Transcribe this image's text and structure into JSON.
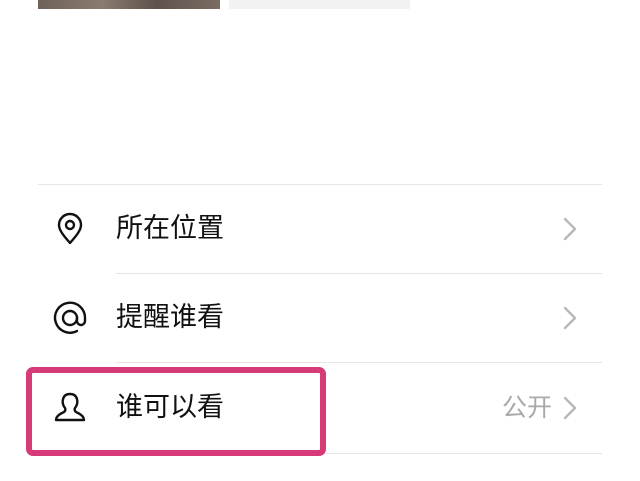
{
  "post_options": {
    "location": {
      "label": "所在位置",
      "icon": "location-pin-icon"
    },
    "mention": {
      "label": "提醒谁看",
      "icon": "at-sign-icon"
    },
    "visibility": {
      "label": "谁可以看",
      "value": "公开",
      "icon": "person-icon"
    }
  },
  "colors": {
    "highlight": "#d63a78",
    "secondary_text": "#a9a9a9",
    "divider": "#e6e6e6"
  }
}
